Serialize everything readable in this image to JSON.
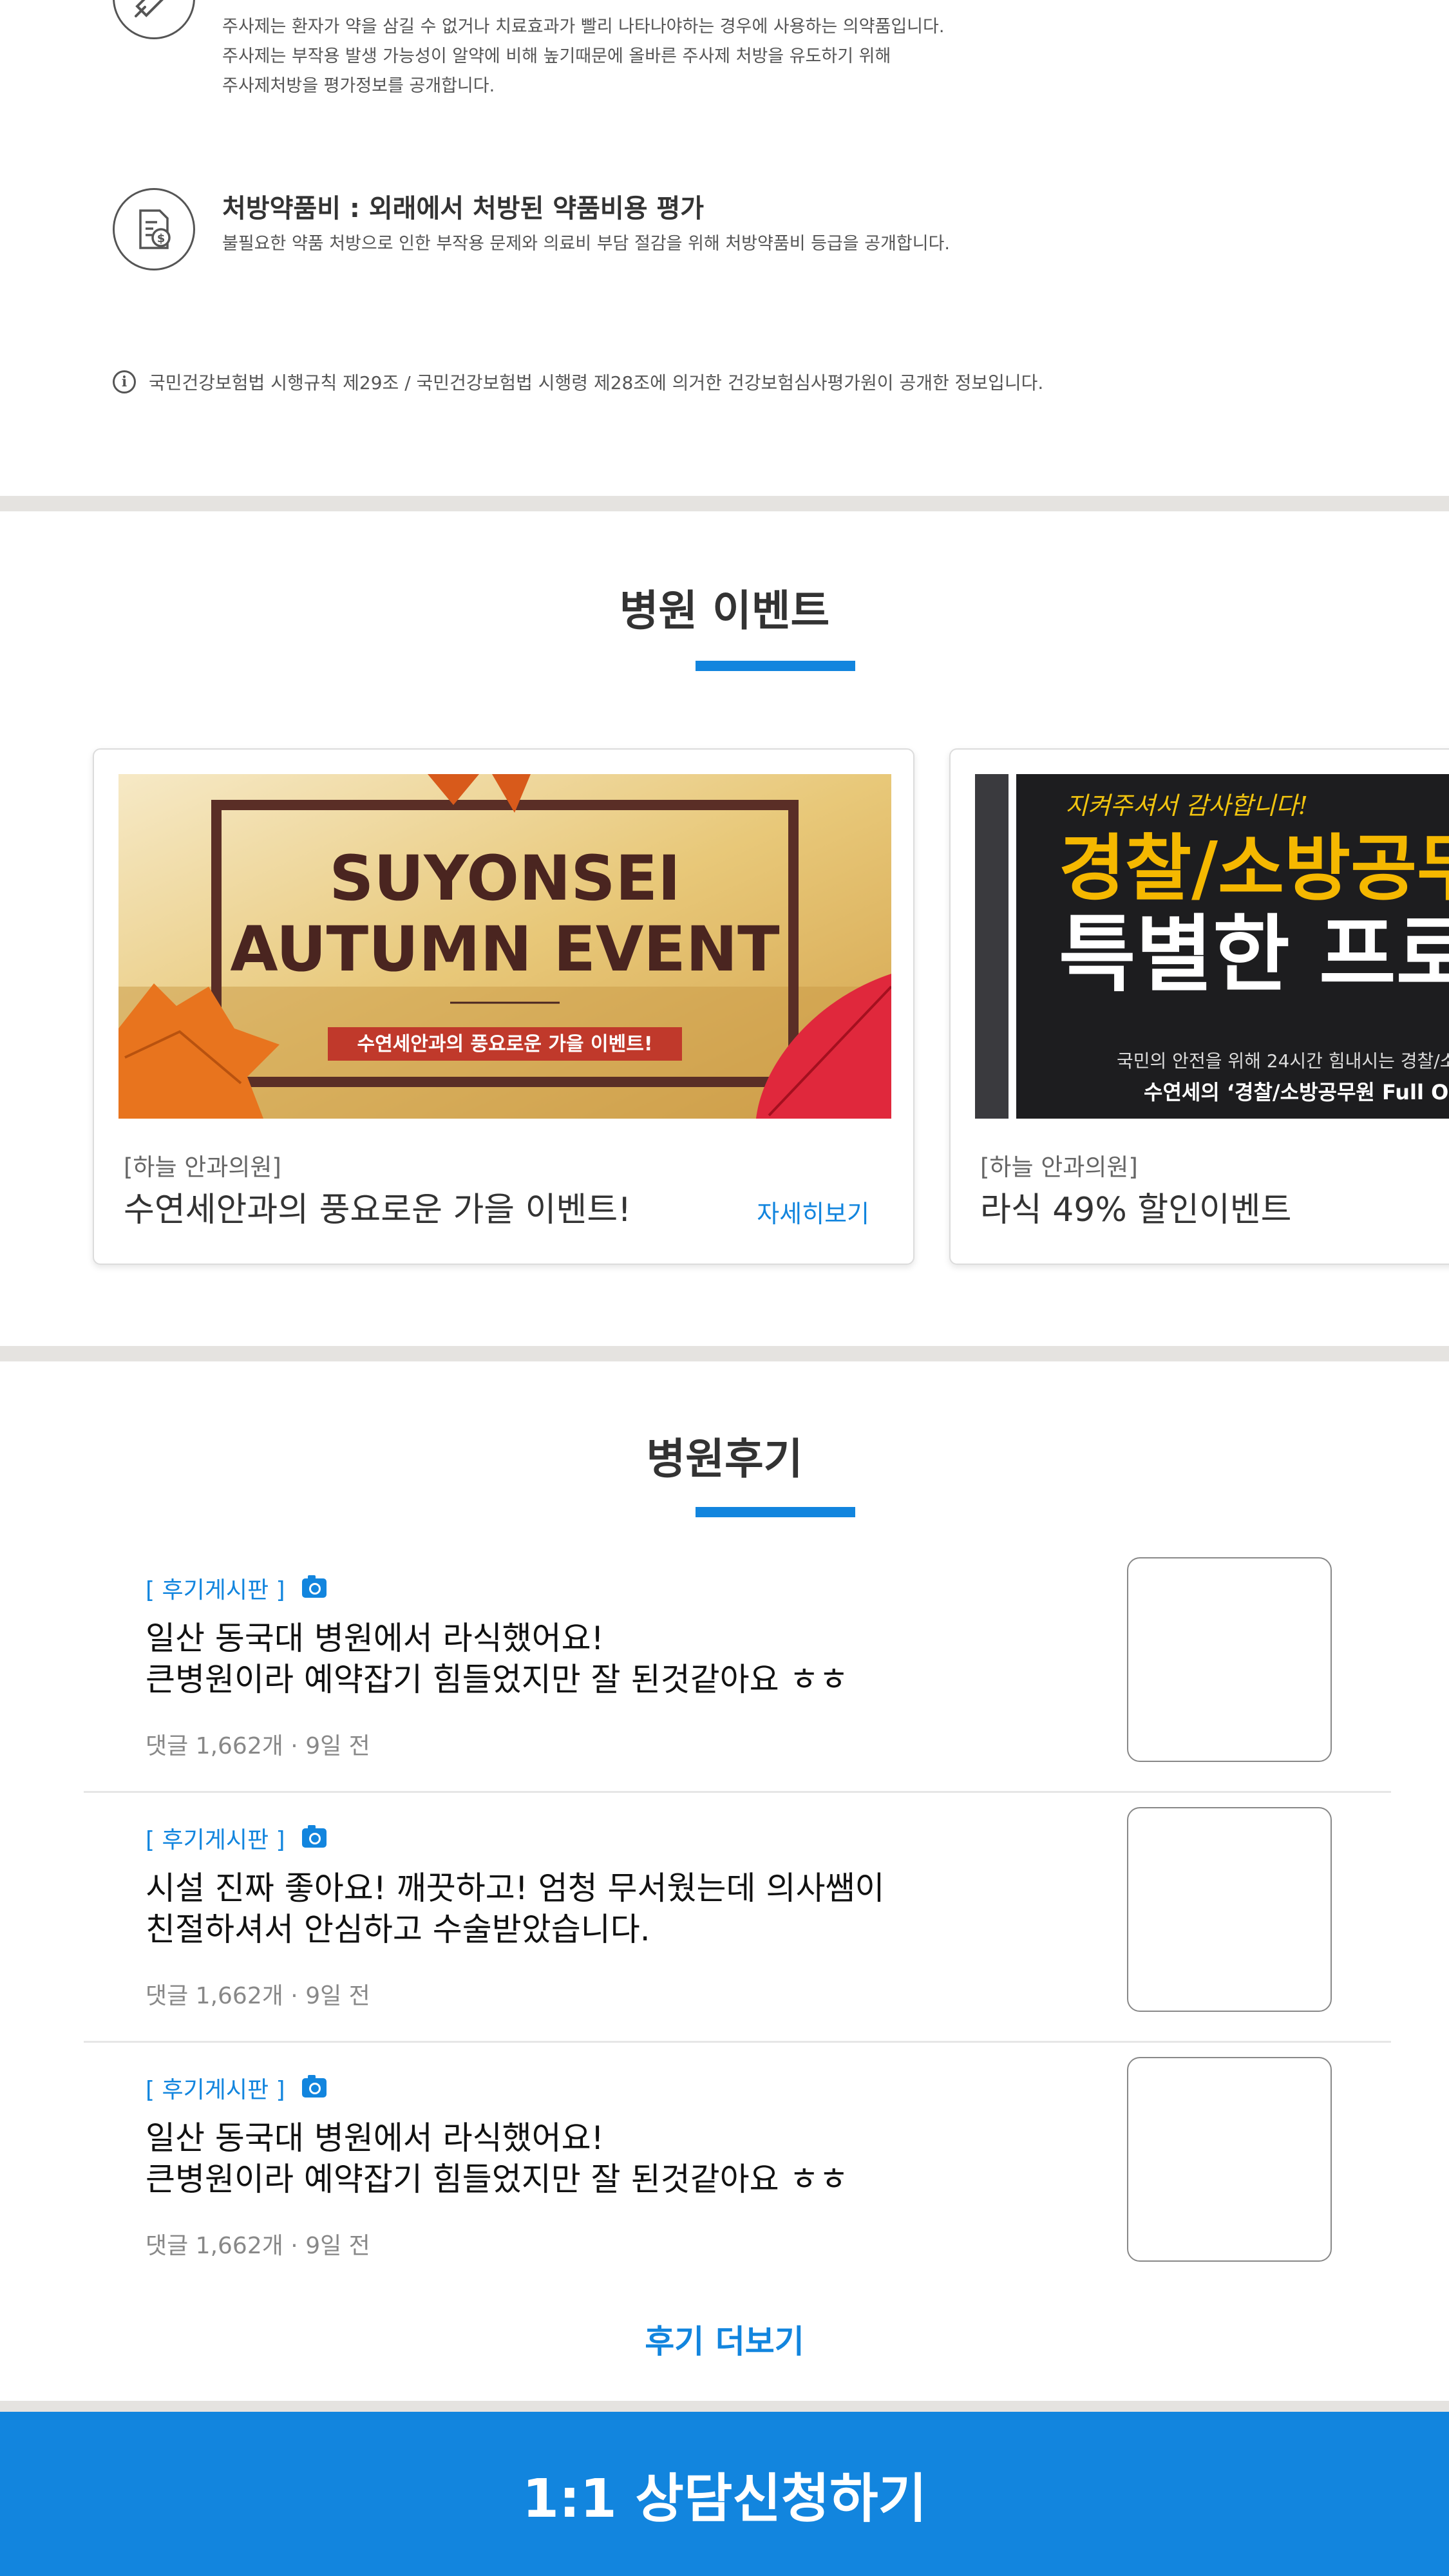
{
  "drug_info": {
    "injection": {
      "icon": "syringe-icon",
      "description": "주사제는 환자가 약을 삼길 수 없거나 치료효과가 빨리 나타나야하는 경우에 사용하는 의약품입니다.\n주사제는 부작용 발생 가능성이 알약에 비해 높기때문에 올바른 주사제 처방을 유도하기 위해\n주사제처방을 평가정보를 공개합니다."
    },
    "prescription_cost": {
      "icon": "document-dollar-icon",
      "title": "처방약품비 : 외래에서 처방된 약품비용 평가",
      "description": "불필요한 약품 처방으로 인한 부작용 문제와 의료비 부담 절감을 위해 처방약품비 등급을 공개합니다."
    },
    "notice": "국민건강보험법 시행규칙 제29조 / 국민건강보험법 시행령 제28조에 의거한 건강보험심사평가원이 공개한 정보입니다."
  },
  "events": {
    "title": "병원 이벤트",
    "more_label": "자세히보기",
    "cards": [
      {
        "hospital": "[하늘 안과의원]",
        "name": "수연세안과의 풍요로운 가을 이벤트!",
        "banner_line1": "SUYONSEI",
        "banner_line2": "AUTUMN EVENT",
        "banner_sub": "수연세안과의 풍요로운 가을 이벤트!"
      },
      {
        "hospital": "[하늘 안과의원]",
        "name": "라식 49% 할인이벤트",
        "banner_script": "지켜주셔서 감사합니다!",
        "banner_line1": "경찰/소방공무",
        "banner_line2": "특별한 프로",
        "banner_small": "국민의 안전을 위해 24시간 힘내시는 경찰/소",
        "banner_sub": "수연세의 ‘경찰/소방공무원 Full O"
      }
    ]
  },
  "reviews": {
    "title": "병원후기",
    "items": [
      {
        "tag": "[ 후기게시판 ]",
        "text": "일산 동국대 병원에서 라식했어요!\n큰병원이라 예약잡기 힘들었지만 잘 된것같아요 ㅎㅎ",
        "meta": "댓글 1,662개 · 9일 전"
      },
      {
        "tag": "[ 후기게시판 ]",
        "text": "시설 진짜 좋아요! 깨끗하고! 엄청 무서웠는데 의사쌤이\n친절하셔서 안심하고 수술받았습니다.",
        "meta": "댓글 1,662개 · 9일 전"
      },
      {
        "tag": "[ 후기게시판 ]",
        "text": "일산 동국대 병원에서 라식했어요!\n큰병원이라 예약잡기 힘들었지만 잘 된것같아요 ㅎㅎ",
        "meta": "댓글 1,662개 · 9일 전"
      }
    ],
    "more_label": "후기 더보기"
  },
  "cta": {
    "label": "1:1 상담신청하기"
  },
  "colors": {
    "accent": "#1285de",
    "divider": "#e5e3e0"
  }
}
